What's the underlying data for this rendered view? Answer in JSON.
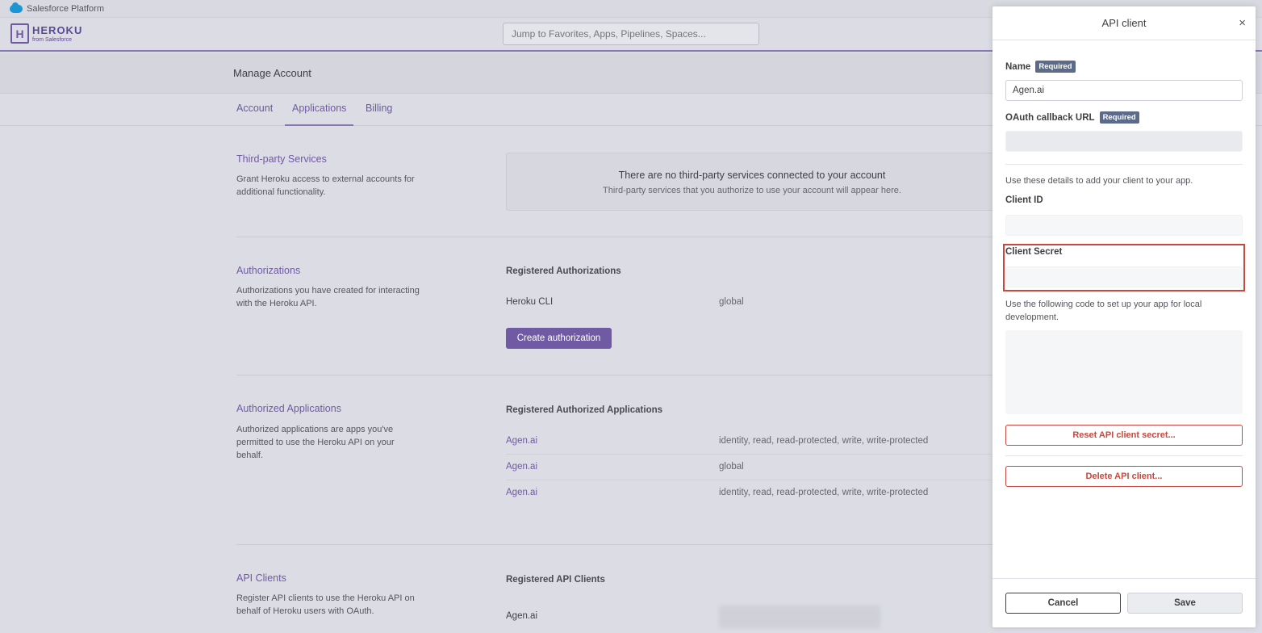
{
  "topbar": {
    "brand": "Salesforce Platform"
  },
  "header": {
    "logo_mark": "H",
    "logo_name": "HEROKU",
    "logo_sub": "from Salesforce",
    "search_placeholder": "Jump to Favorites, Apps, Pipelines, Spaces..."
  },
  "page": {
    "title": "Manage Account"
  },
  "tabs": [
    {
      "label": "Account",
      "active": false
    },
    {
      "label": "Applications",
      "active": true
    },
    {
      "label": "Billing",
      "active": false
    }
  ],
  "third_party": {
    "title": "Third-party Services",
    "desc": "Grant Heroku access to external accounts for additional functionality.",
    "empty_title": "There are no third-party services connected to your account",
    "empty_desc": "Third-party services that you authorize to use your account will appear here."
  },
  "authorizations": {
    "title": "Authorizations",
    "desc": "Authorizations you have created for interacting with the Heroku API.",
    "table_head": "Registered Authorizations",
    "rows": [
      {
        "name": "Heroku CLI",
        "scope": "global"
      }
    ],
    "create_button": "Create authorization"
  },
  "authorized_apps": {
    "title": "Authorized Applications",
    "desc": "Authorized applications are apps you've permitted to use the Heroku API on your behalf.",
    "table_head": "Registered Authorized Applications",
    "rows": [
      {
        "name": "Agen.ai",
        "scope": "identity, read, read-protected, write, write-protected"
      },
      {
        "name": "Agen.ai",
        "scope": "global"
      },
      {
        "name": "Agen.ai",
        "scope": "identity, read, read-protected, write, write-protected"
      }
    ]
  },
  "api_clients": {
    "title": "API Clients",
    "desc": "Register API clients to use the Heroku API on behalf of Heroku users with OAuth.",
    "table_head": "Registered API Clients",
    "rows": [
      {
        "name": "Agen.ai"
      }
    ]
  },
  "panel": {
    "title": "API client",
    "close_glyph": "×",
    "name_label": "Name",
    "required_badge": "Required",
    "name_value": "Agen.ai",
    "callback_label": "OAuth callback URL",
    "details_text": "Use these details to add your client to your app.",
    "client_id_label": "Client ID",
    "client_secret_label": "Client Secret",
    "code_text": "Use the following code to set up your app for local development.",
    "reset_button": "Reset API client secret...",
    "delete_button": "Delete API client...",
    "cancel_button": "Cancel",
    "save_button": "Save"
  },
  "colors": {
    "accent": "#6f5aa3",
    "danger": "#c8473e",
    "badge": "#5d6b8a"
  }
}
